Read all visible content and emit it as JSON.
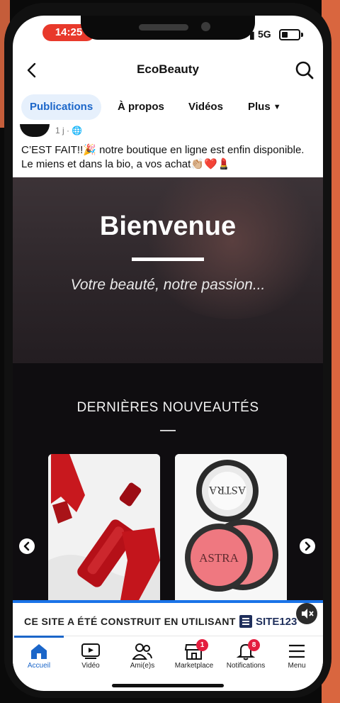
{
  "status_bar": {
    "time": "14:25",
    "network": "5G"
  },
  "header": {
    "title": "EcoBeauty"
  },
  "tabs": [
    {
      "label": "Publications"
    },
    {
      "label": "À propos"
    },
    {
      "label": "Vidéos"
    },
    {
      "label": "Plus"
    }
  ],
  "post": {
    "time": "1 j ·",
    "text": "C’EST FAIT!!🎉 notre boutique en ligne est enfin disponible. Le miens et dans la bio, a vos achat👏🏼❤️💄"
  },
  "website": {
    "hero_title": "Bienvenue",
    "hero_subtitle": "Votre beauté, notre passion...",
    "section_title": "DERNIÈRES NOUVEAUTÉS",
    "product2_label_top": "ASTRA",
    "product2_label_bottom": "ASTRA"
  },
  "banner": {
    "text": "CE SITE A ÉTÉ CONSTRUIT EN UTILISANT",
    "brand": "SITE",
    "brand_suffix": "123"
  },
  "bottom_nav": [
    {
      "label": "Accueil"
    },
    {
      "label": "Vidéo"
    },
    {
      "label": "Ami(e)s"
    },
    {
      "label": "Marketplace",
      "badge": "1"
    },
    {
      "label": "Notifications",
      "badge": "8"
    },
    {
      "label": "Menu"
    }
  ],
  "colors": {
    "accent": "#1b66c9",
    "badge": "#e41e3f",
    "site_dark": "#0f0d10"
  }
}
